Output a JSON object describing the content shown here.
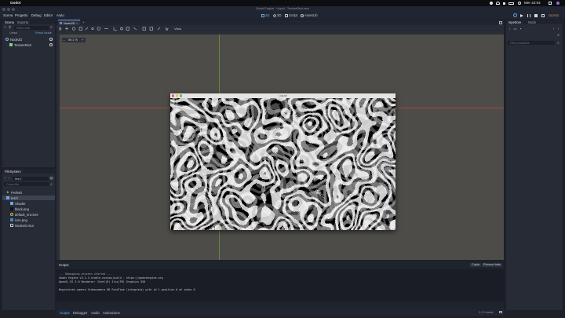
{
  "mac_menu": {
    "apple": "",
    "app": "Godot",
    "status_right": "Mer 22:04"
  },
  "window_title": "Godot Engine - Liquid - TextureRect.tscn",
  "editor_menu": [
    "Scena",
    "Progetto",
    "Debug",
    "Editor",
    "Aiuto"
  ],
  "workspaces": [
    {
      "label": "2D",
      "active": true
    },
    {
      "label": "3D",
      "active": false
    },
    {
      "label": "Script",
      "active": false
    },
    {
      "label": "AssetLib",
      "active": false
    }
  ],
  "renderer": "GLES3",
  "scene_dock": {
    "tabs": [
      "Scena",
      "Importa"
    ],
    "filter_placeholder": "Filtra nodi",
    "buttons": [
      "Unisci",
      "Rendi locale"
    ],
    "nodes": [
      {
        "label": "Node2D"
      },
      {
        "label": "TextureRect"
      }
    ]
  },
  "filesystem_dock": {
    "title": "FileSystem",
    "path": "res://",
    "search_placeholder": "Cerca file",
    "items": [
      {
        "label": "Preferiti",
        "type": "favorites"
      },
      {
        "label": "res://",
        "type": "folder",
        "selected": true
      },
      {
        "label": "Shader",
        "type": "folder"
      },
      {
        "label": "black.png",
        "type": "file"
      },
      {
        "label": "default_env.tres",
        "type": "file"
      },
      {
        "label": "icon.png",
        "type": "file"
      },
      {
        "label": "Node2D.tscn",
        "type": "file"
      }
    ]
  },
  "scene_tab": "Node2D",
  "toolbar": {
    "view_label": "Vista",
    "zoom": "59.1 %"
  },
  "game_window": {
    "title": "Liquid"
  },
  "output_panel": {
    "title": "Output",
    "copy_button": "Copia",
    "clear_button": "Rimuovi tutto",
    "lines": [
      "--- Debugging process started ---",
      "Godot Engine v3.2.3.stable.custom_build - https://godotengine.org",
      "OpenGL ES 3.0 Renderer: Intel(R) Iris(TM) Graphics 550",
      "",
      "Registered camera Videocamera HD FaceTime (integrata) with id 1 position 0 at index 0"
    ]
  },
  "bottom_tabs": [
    {
      "label": "Output",
      "active": true
    },
    {
      "label": "Debugger",
      "active": false
    },
    {
      "label": "Audio",
      "active": false
    },
    {
      "label": "Animazione",
      "active": false
    }
  ],
  "version": "3.2.3.stable",
  "inspector_dock": {
    "tabs": [
      "Ispettore",
      "Nodo"
    ],
    "filter_placeholder": "Filtra proprietà"
  },
  "colors": {
    "accent": "#69a7e6",
    "viewport_bg": "#4d4c48",
    "guide_red": "#b04848",
    "guide_green": "#6a9a3c",
    "traffic_red": "#ec5f59",
    "traffic_yellow": "#f4bf4f",
    "traffic_green": "#61c554"
  }
}
